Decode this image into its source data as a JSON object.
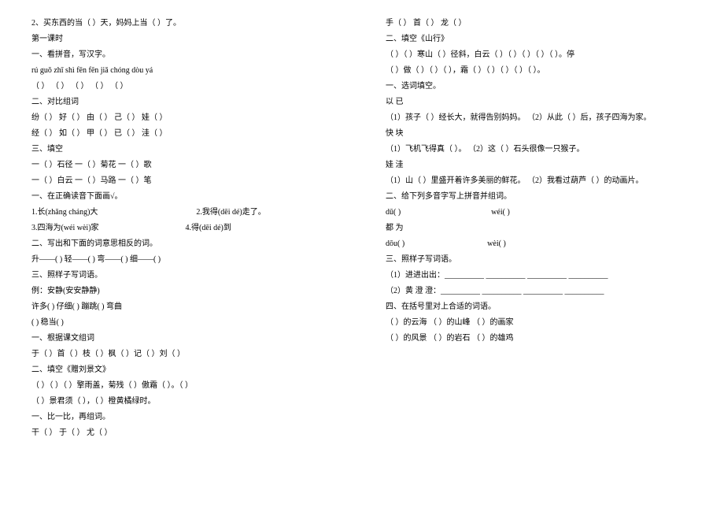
{
  "left": {
    "l1": "2、买东西的当（        ）天，妈妈上当（        ）了。",
    "l2": "第一课时",
    "l3": "一、看拼音，写汉字。",
    "l4": "rú  guǒ    zhī  shì    fēn  fēn    jiǎ  chóng    dòu  yá",
    "l5": "（        ）   （        ）   （        ）   （        ）   （        ）",
    "l6": " 二、对比组词",
    "l7": "纷（          ）   好（          ）      由（          ）      己（          ）      娃（          ）",
    "l8": "经（          ）   如（          ）      甲（          ）      已（          ）      洼（          ）",
    "l9": "三、填空",
    "l10": "一（        ）石径   一（        ）菊花   一（          ）歌",
    "l11": "一（        ）白云   一（        ）马路   一（          ）笔",
    "l12": "一、在正确读音下面画√。",
    "l13_a": "1.长(zhǎng cháng)大",
    "l13_b": "2.我得(dēi dé)走了。",
    "l14_a": "3.四海为(wéi wèi)家",
    "l14_b": "4.得(dēi dé)到",
    "l15": "二、写出和下面的词意思相反的词。",
    "l16": "升——(          )   轻——(          )   弯——(          )   细——(          )",
    "l17": "三、照样子写词语。",
    "l18": "例：安静(安安静静)",
    "l19": "许多(                    )   仔细(                    )   蹦跳(                    )   弯曲",
    "l20": "(                    )   稳当(                    )",
    "l21": "一、根据课文组词",
    "l22": "于（        ）首（        ）枝（        ）枫（        ）记（        ）刘（        ）",
    "l23": "二、填空《赠刘景文》",
    "l24": "   （        ）（        ）（        ）擎雨盖，菊残（        ）傲霜（        ）。（        ）",
    "l25": "（        ）景君须（        ），（        ）橙黄橘绿时。",
    "l26": "一、比一比，再组词。",
    "l27": "干（            ）    于（            ）    尤（            ）"
  },
  "right": {
    "r1": "手（            ）    首（            ）    龙（            ）",
    "r2": "二、填空《山行》",
    "r3": "   （        ）（        ）寒山（        ）径斜，白云（        ）（        ）（        ）（        ）（        ）。停",
    "r4": "（        ）做（        ）（        ）（        ），霜（        ）（        ）（        ）（        ）（        ）。",
    "r5": "一、选词填空。",
    "r6": "                                                    以    已",
    "r7": "（1）孩子（      ）经长大，就得告别妈妈。 （2）从此（      ）后，孩子四海为家。",
    "r8": "                                                    快   块",
    "r9": "（1）飞机飞得真（       ）。 （2）这（       ）石头很像一只猴子。",
    "r10": "                                                    娃   洼",
    "r11": "（1）山（       ）里盛开着许多美丽的鲜花。   （2）我看过葫芦（       ）的动画片。",
    "r12": "二、给下列多音字写上拼音并组词。",
    "r13_a": "    dū(            )",
    "r13_b": "wéi(            )",
    "r14_a": "都                                    为",
    "r15_a": "    dōu(            )",
    "r15_b": "wèi(            )",
    "r16": "三、照样子写词语。",
    "r17": "（1）进进出出：__________  __________  __________  __________",
    "r18": "（2）黄 澄 澄：__________  __________  __________  __________",
    "r19": "四、在括号里对上合适的词语。",
    "r20": "   （            ）的云海     （               ）的山峰    （            ）的画家",
    "r21": "   （            ）的风景     （               ）的岩石    （            ）的雄鸡"
  }
}
